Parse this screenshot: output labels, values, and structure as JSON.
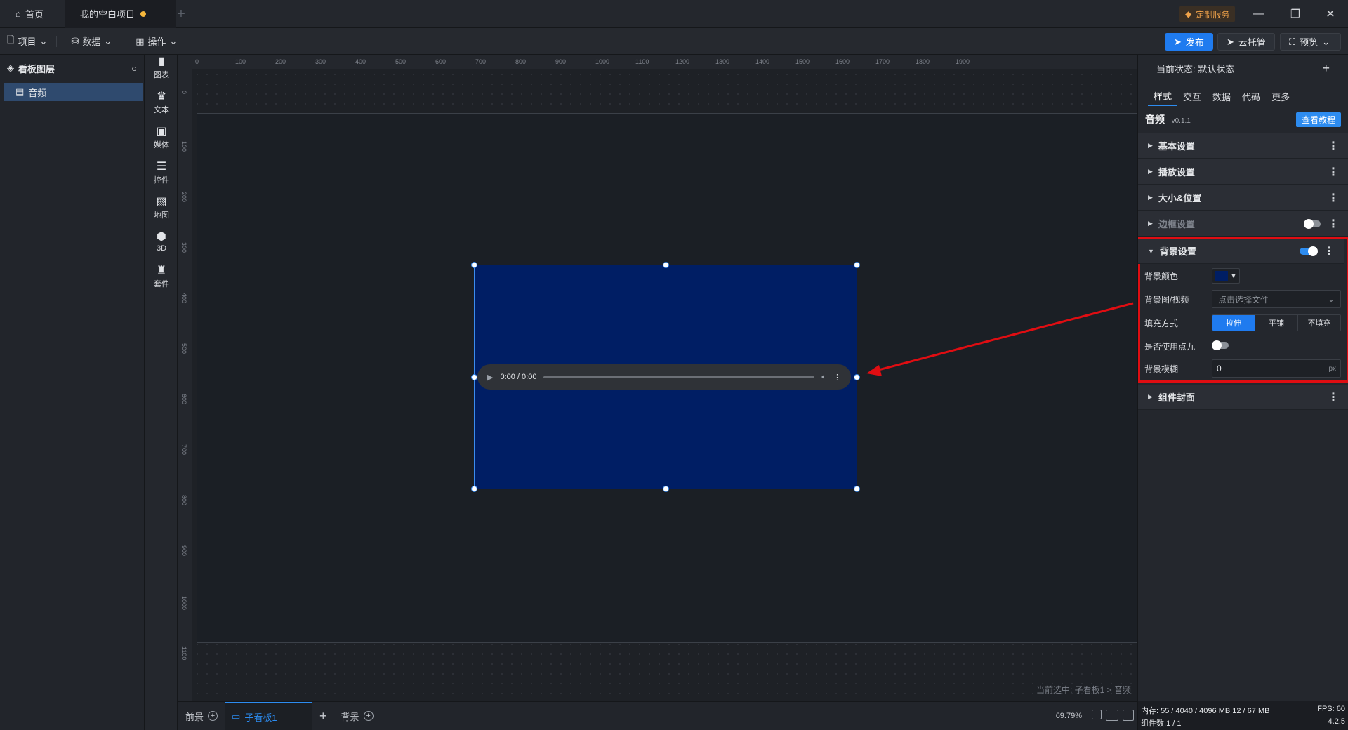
{
  "titlebar": {
    "home_tab": "首页",
    "project_tab": "我的空白项目",
    "custom_service": "定制服务"
  },
  "menubar": {
    "items": [
      "项目",
      "数据",
      "操作"
    ],
    "publish": "发布",
    "cloud": "云托管",
    "preview": "预览"
  },
  "layers": {
    "title": "看板图层",
    "items": [
      "音频"
    ]
  },
  "component_tools": [
    "图表",
    "文本",
    "媒体",
    "控件",
    "地图",
    "3D",
    "套件"
  ],
  "rulers": {
    "top": [
      "0",
      "100",
      "200",
      "300",
      "400",
      "500",
      "600",
      "700",
      "800",
      "900",
      "1000",
      "1100",
      "1200",
      "1300",
      "1400",
      "1500",
      "1600",
      "1700",
      "1800",
      "1900"
    ],
    "left": [
      "0",
      "100",
      "200",
      "300",
      "400",
      "500",
      "600",
      "700",
      "800",
      "900",
      "1000",
      "1100"
    ]
  },
  "canvas": {
    "audio_time": "0:00 / 0:00",
    "selection_path": "当前选中: 子看板1 > 音频"
  },
  "bottombar": {
    "tabs": [
      "前景",
      "子看板1",
      "背景"
    ],
    "zoom": "69.79%"
  },
  "right_panel": {
    "state_label": "当前状态:",
    "state_value": "默认状态",
    "tabs": [
      "样式",
      "交互",
      "数据",
      "代码",
      "更多"
    ],
    "component_name": "音频",
    "component_version": "v0.1.1",
    "tutorial": "查看教程",
    "sections": [
      "基本设置",
      "播放设置",
      "大小&位置",
      "边框设置",
      "背景设置",
      "组件封面"
    ],
    "background": {
      "color_label": "背景颜色",
      "color_value": "#001e64",
      "image_label": "背景图/视频",
      "image_placeholder": "点击选择文件",
      "fill_label": "填充方式",
      "fill_options": [
        "拉伸",
        "平铺",
        "不填充"
      ],
      "fill_selected": "拉伸",
      "nine_label": "是否使用点九",
      "blur_label": "背景模糊",
      "blur_value": "0",
      "blur_unit": "px"
    }
  },
  "status": {
    "memory_label": "内存:",
    "memory_value": "55 / 4040 / 4096 MB",
    "mem2": "12 / 67 MB",
    "fps_label": "FPS:",
    "fps_value": "60",
    "count_label": "组件数:",
    "count_value": "1 / 1",
    "version": "4.2.5"
  },
  "colors": {
    "accent": "#2d8cf0",
    "component_bg": "#001e64",
    "annotation": "#e00d12"
  }
}
